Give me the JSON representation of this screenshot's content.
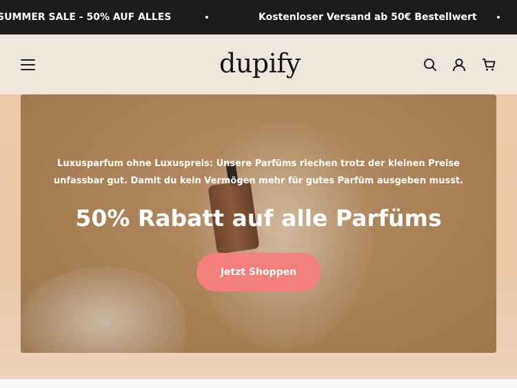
{
  "announcement": {
    "messages": [
      "SUMMER SALE - 50% AUF ALLES",
      "Kostenloser Versand ab 50€ Bestellwert"
    ]
  },
  "header": {
    "logo": "dupify",
    "icons": [
      "menu-icon",
      "search-icon",
      "account-icon",
      "cart-icon"
    ]
  },
  "hero": {
    "intro": "Luxusparfum ohne Luxuspreis: Unsere Parfüms riechen trotz der kleinen Preise unfassbar gut. Damit du kein Vermögen mehr für gutes Parfüm ausgeben musst.",
    "title": "50% Rabatt auf alle Parfüms",
    "cta_label": "Jetzt Shoppen"
  },
  "colors": {
    "announcement_bg": "#1b1b1b",
    "header_bg": "#efe6dc",
    "cta_bg": "#f47f7c",
    "text_dark": "#1b1b1b"
  }
}
